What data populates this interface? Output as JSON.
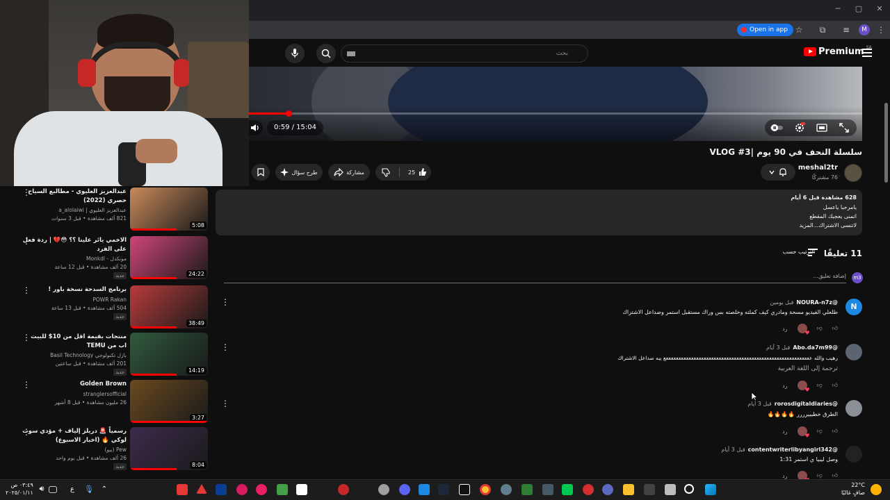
{
  "browser": {
    "open_in_app": "Open in app",
    "profile_initial": "M"
  },
  "header": {
    "search_placeholder": "بحث",
    "logo_word": "Premium",
    "logo_country": "SA"
  },
  "player": {
    "time": "0:59 / 15:04",
    "progress_fraction": 0.065
  },
  "video": {
    "title": "سلسلة النحف في 90 يوم |VLOG #3",
    "channel_name": "meshal2tr",
    "subscribers": "76 مشتركًا",
    "likes": "25",
    "share_label": "مشاركة",
    "ask_label": "طرح سؤال"
  },
  "description": {
    "stats": "628 مشاهدة  قبل 6 أيام",
    "line1": "يامرحبا ياعسل",
    "line2": "اتمنى يعجبك المقطع",
    "line3": "لاتنسى الاشتراك...المزيد"
  },
  "comments": {
    "count_label": "11 تعليقًا",
    "sort_label": "الترتيب حسب",
    "my_initial": "m3",
    "add_placeholder": "إضافة تعليق...",
    "reply_label": "رد",
    "items": [
      {
        "author": "@NOURA-n7z",
        "time": "قبل يومين",
        "text": "طلعلي الفيديو مسحة ومادري كيف كملته وخلصته بس وراك مستقبل استمر وضداعل الاشتراك",
        "initial": "N",
        "avatar_color": "#1e88e5"
      },
      {
        "author": "@Abo.da7m99",
        "time": "قبل 3 أيام",
        "text": "رهيب والله ععععععععععععععععععععععععععععععععععععععععععععععععععععععععععع يبه صداعل الاشتراك",
        "translate": "ترجمة إلى اللغة العربية",
        "initial": "",
        "avatar_color": "#5b6470"
      },
      {
        "author": "@rorosdigitaldiaries",
        "time": "قبل 3 أيام",
        "text": "الطرق خطيييرررر 🔥🔥🔥🔥",
        "initial": "",
        "avatar_color": "#8a8f96"
      },
      {
        "author": "@contentwriterlibyangirl342",
        "time": "قبل 3 أيام",
        "text": "وصل ليبيا ي استمر 1:31",
        "initial": "",
        "avatar_color": "#222"
      }
    ]
  },
  "related": [
    {
      "title": "عبدالعزيز العليوي - مطالبع السياح حصري (2022)",
      "channel": "عبدالعزيز العليوي | a_alolaiwi",
      "meta": "821 ألف مشاهدة • قبل 3 سنوات",
      "duration": "5:08",
      "badge": "",
      "thumb_color": "#c98a5a"
    },
    {
      "title": "الاخمي يائر علينا ؟؟ 😳💔 | ردة فعل على الفرد",
      "channel": "مونكدل - Monkdl",
      "meta": "20 ألف مشاهدة • قبل 12 ساعة",
      "duration": "24:22",
      "badge": "جديد",
      "thumb_color": "#d0457a"
    },
    {
      "title": "برنامج السدحة نسخة باور !",
      "channel": "POWR Rakan",
      "meta": "504 ألف مشاهدة • قبل 13 ساعة",
      "duration": "38:49",
      "badge": "جديد",
      "thumb_color": "#b93b3b"
    },
    {
      "title": "منتجات بقيمة اقل من 10$ للبيت اب من TEMU",
      "channel": "بازل تكنولوجي Basil Technology",
      "meta": "201 ألف مشاهدة • قبل ساعتين",
      "duration": "14:19",
      "badge": "جديد",
      "thumb_color": "#2f5a3d"
    },
    {
      "title": "Golden Brown",
      "channel": "stranglersofficial",
      "meta": "26 مليون مشاهدة • قبل 8 أشهر",
      "duration": "3:27",
      "badge": "",
      "thumb_color": "#6b4a1e"
    },
    {
      "title": "رسمياً 🚨 دريلز إلياف + مؤدي سوت لوكي 🔥 (اخبار الاسبوع)",
      "channel": "Pew (بيو)",
      "meta": "26 ألف مشاهدة • قبل يوم واحد",
      "duration": "8:04",
      "badge": "جديد",
      "thumb_color": "#3d2b4d"
    }
  ],
  "taskbar": {
    "time": "٠٣:٤٩ ص",
    "date": "٢٠٢٥/٠١/١١",
    "weather_temp": "22°C",
    "weather_desc": "صافٍ غالبًا",
    "lang": "ع"
  },
  "colors": {
    "accent_red": "#ff0000",
    "chrome_blue": "#1a73e8",
    "background": "#0f0f0f"
  }
}
